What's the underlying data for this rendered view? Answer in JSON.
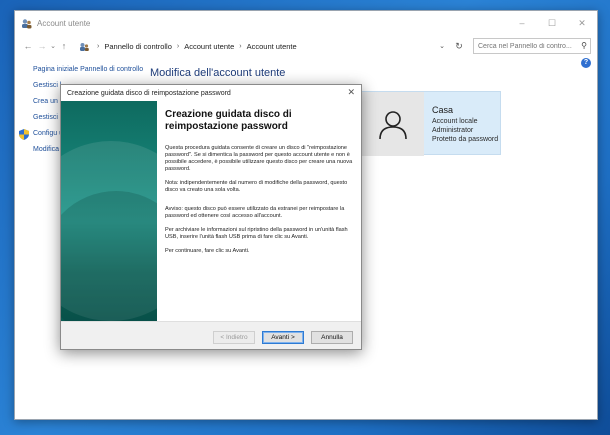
{
  "window": {
    "title": "Account utente",
    "controls": {
      "minimize": "–",
      "maximize": "☐",
      "close": "✕"
    }
  },
  "address": {
    "back": "←",
    "forward": "→",
    "recent": "⌄",
    "up": "↑",
    "crumbs": [
      "Pannello di controllo",
      "Account utente",
      "Account utente"
    ],
    "separator": "›",
    "dropdown": "⌄",
    "refresh": "↻",
    "search_placeholder": "Cerca nel Pannello di contro...",
    "search_glyph": "⚲"
  },
  "left_pane": {
    "links": [
      "Pagina iniziale Pannello di controllo",
      "Gestisci l",
      "Crea un d reimpost",
      "Gestisci i crittogra",
      "Configu utente es",
      "Modifica"
    ]
  },
  "page_title": "Modifica dell'account utente",
  "help_glyph": "?",
  "user": {
    "name": "Casa",
    "lines": [
      "Account locale",
      "Administrator",
      "Protetto da password"
    ]
  },
  "wizard": {
    "title": "Creazione guidata disco di reimpostazione password",
    "close": "✕",
    "heading": "Creazione guidata disco di reimpostazione password",
    "paragraphs": [
      "Questa procedura guidata consente di creare un disco di \"reimpostazione password\". Se si dimentica la password per questo account utente e non è possibile accedere, è possibile utilizzare questo disco per creare una nuova password.",
      "Nota: indipendentemente dal numero di modifiche della password, questo disco va creato una sola volta.",
      "Avviso: questo disco può essere utilizzato da estranei per reimpostare la password ed ottenere così accesso all'account.",
      "Per archiviare le informazioni sul ripristino della password in un'unità flash USB, inserire l'unità flash USB prima di fare clic su Avanti.",
      "Per continuare, fare clic su Avanti."
    ],
    "buttons": {
      "back": "< Indietro",
      "next": "Avanti >",
      "cancel": "Annulla"
    }
  }
}
